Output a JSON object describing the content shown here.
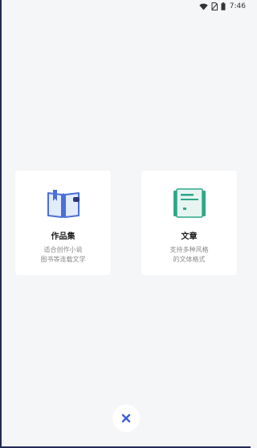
{
  "status_bar": {
    "time": "7:46",
    "icons": [
      "wifi-icon",
      "no-sim-icon",
      "battery-icon"
    ]
  },
  "cards": [
    {
      "title": "作品集",
      "desc_line1": "适合创作小说",
      "desc_line2": "图书等连载文学",
      "icon": "book-icon",
      "accent": "#4a6fd8"
    },
    {
      "title": "文章",
      "desc_line1": "支持多种风格",
      "desc_line2": "的文体格式",
      "icon": "document-icon",
      "accent": "#2fa789"
    }
  ],
  "close_button": {
    "icon": "close-icon",
    "color": "#3d5fd6"
  }
}
